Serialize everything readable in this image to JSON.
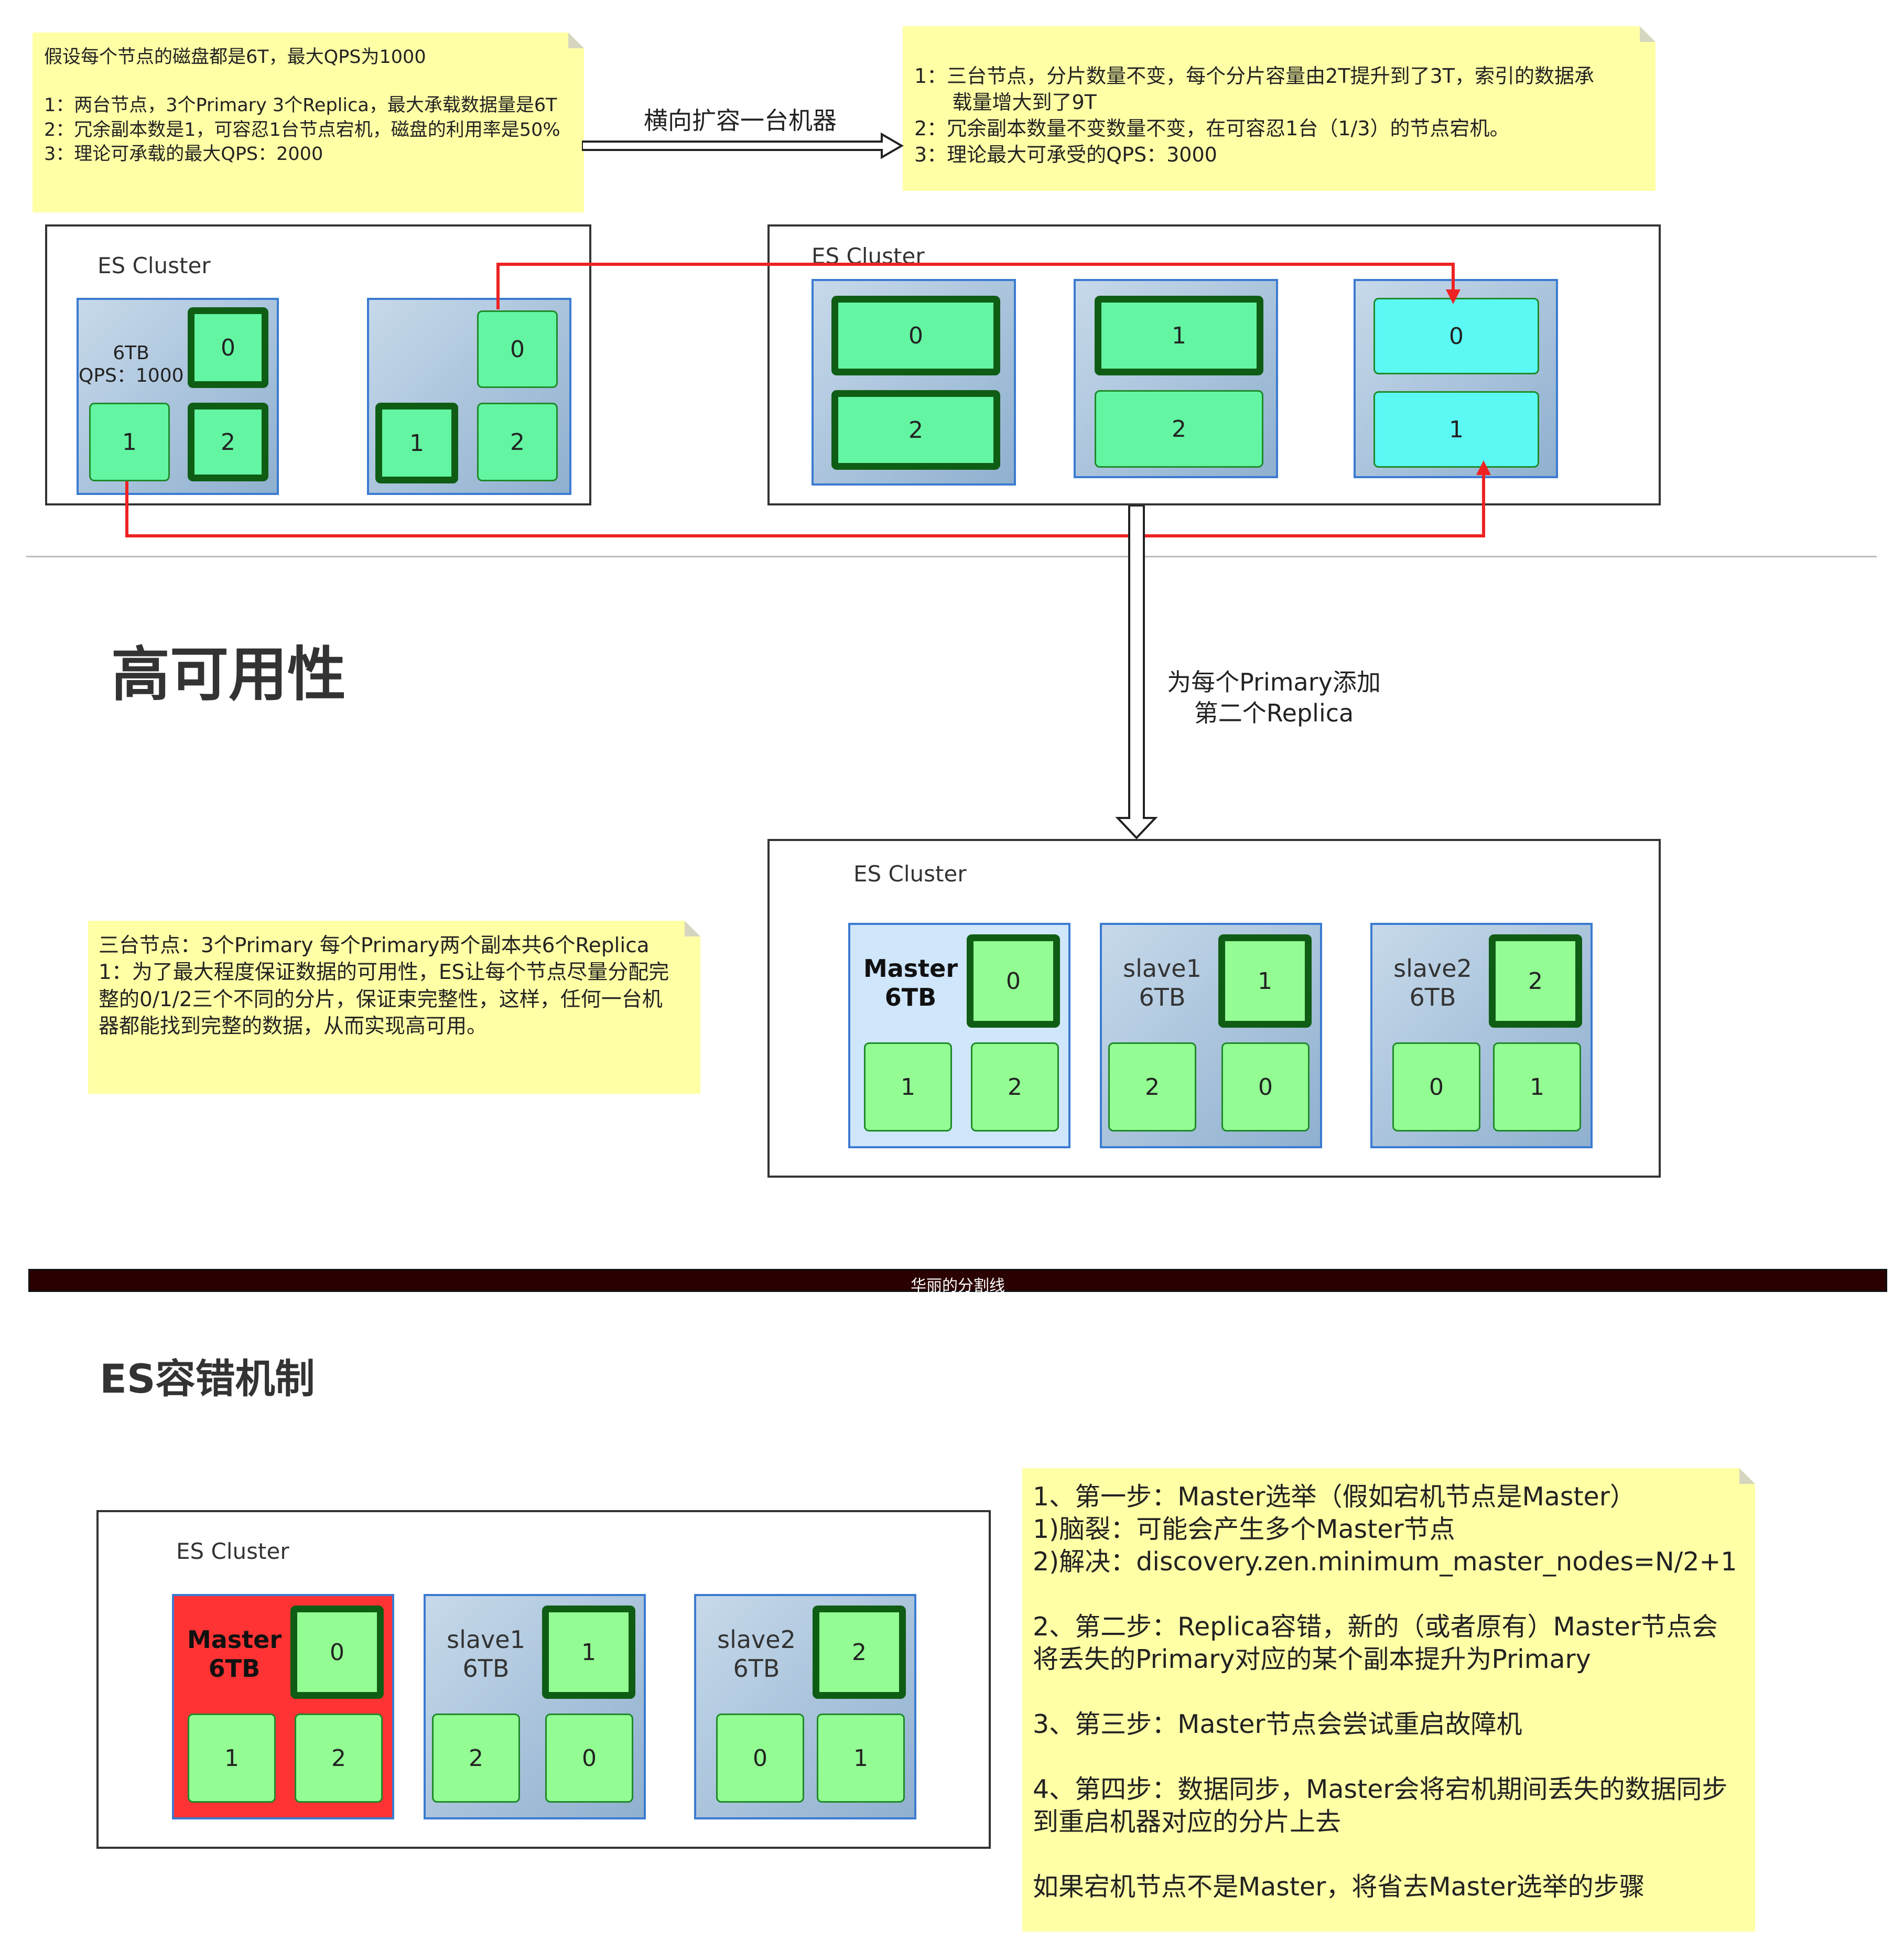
{
  "top": {
    "note_left": {
      "lines": "假设每个节点的磁盘都是6T，最大QPS为1000\n\n1：两台节点，3个Primary 3个Replica，最大承载数据量是6T\n2：冗余副本数是1，可容忍1台节点宕机，磁盘的利用率是50%\n3：理论可承载的最大QPS：2000"
    },
    "arrow_label": "横向扩容一台机器",
    "note_right": {
      "lines": "1：三台节点，分片数量不变，每个分片容量由2T提升到了3T，索引的数据承\n      载量增大到了9T\n2：冗余副本数量不变数量不变，在可容忍1台（1/3）的节点宕机。\n3：理论最大可承受的QPS：3000"
    },
    "cluster_left": {
      "label": "ES Cluster",
      "node1": {
        "label": "6TB\nQPS：1000",
        "shards": [
          "0",
          "1",
          "2"
        ]
      },
      "node2": {
        "shards": [
          "0",
          "1",
          "2"
        ]
      }
    },
    "cluster_right": {
      "label": "ES Cluster",
      "node1": {
        "shards": [
          "0",
          "2"
        ]
      },
      "node2": {
        "shards": [
          "1",
          "2"
        ]
      },
      "node3": {
        "shards": [
          "0",
          "1"
        ]
      }
    }
  },
  "ha": {
    "title": "高可用性",
    "arrow_label": "为每个Primary添加\n第二个Replica",
    "note": {
      "lines": "三台节点：3个Primary 每个Primary两个副本共6个Replica\n1：为了最大程度保证数据的可用性，ES让每个节点尽量分配完\n整的0/1/2三个不同的分片，保证束完整性，这样，任何一台机\n器都能找到完整的数据，从而实现高可用。"
    },
    "cluster": {
      "label": "ES Cluster",
      "master": {
        "label": "Master\n6TB",
        "primary": "0",
        "replicas": [
          "1",
          "2"
        ]
      },
      "slave1": {
        "label": "slave1\n6TB",
        "primary": "1",
        "replicas": [
          "2",
          "0"
        ]
      },
      "slave2": {
        "label": "slave2\n6TB",
        "primary": "2",
        "replicas": [
          "0",
          "1"
        ]
      }
    }
  },
  "divider": {
    "label": "华丽的分割线"
  },
  "ft": {
    "title": "ES容错机制",
    "cluster": {
      "label": "ES Cluster",
      "master": {
        "label": "Master\n6TB",
        "primary": "0",
        "replicas": [
          "1",
          "2"
        ]
      },
      "slave1": {
        "label": "slave1\n6TB",
        "primary": "1",
        "replicas": [
          "2",
          "0"
        ]
      },
      "slave2": {
        "label": "slave2\n6TB",
        "primary": "2",
        "replicas": [
          "0",
          "1"
        ]
      }
    },
    "note": {
      "lines": "1、第一步：Master选举（假如宕机节点是Master）\n1)脑裂：可能会产生多个Master节点\n2)解决：discovery.zen.minimum_master_nodes=N/2+1\n\n2、第二步：Replica容错，新的（或者原有）Master节点会\n将丢失的Primary对应的某个副本提升为Primary\n\n3、第三步：Master节点会尝试重启故障机\n\n4、第四步：数据同步，Master会将宕机期间丢失的数据同步\n到重启机器对应的分片上去\n\n如果宕机节点不是Master，将省去Master选举的步骤"
    }
  },
  "colors": {
    "note": "#ffffa6",
    "primary_shard": "#63f5a2",
    "replica_shard": "#93fc93",
    "new_node_shard": "#5cf9f4",
    "failed_master": "#ff3333",
    "move_line": "#ee2222",
    "divider_bar": "#2a0000"
  }
}
